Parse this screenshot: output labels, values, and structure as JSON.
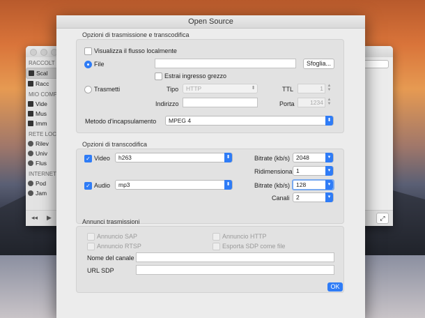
{
  "background_window": {
    "sidebar": {
      "sections": [
        {
          "header": "RACCOLT",
          "items": [
            {
              "label": "Scal"
            },
            {
              "label": "Racc"
            }
          ]
        },
        {
          "header": "MIO COMP",
          "items": [
            {
              "label": "Vide"
            },
            {
              "label": "Mus"
            },
            {
              "label": "Imm"
            }
          ]
        },
        {
          "header": "RETE LOC",
          "items": [
            {
              "label": "Rilev"
            },
            {
              "label": "Univ"
            },
            {
              "label": "Flus"
            }
          ]
        },
        {
          "header": "INTERNET",
          "items": [
            {
              "label": "Pod"
            },
            {
              "label": "Jam"
            }
          ]
        }
      ]
    }
  },
  "dialog": {
    "title": "Open Source",
    "streaming": {
      "group_title": "Opzioni di trasmissione e transcodifica",
      "show_locally_label": "Visualizza il flusso localmente",
      "file_label": "File",
      "file_value": "",
      "browse_label": "Sfoglia...",
      "raw_input_label": "Estrai ingresso grezzo",
      "transmit_label": "Trasmetti",
      "type_label": "Tipo",
      "type_value": "HTTP",
      "ttl_label": "TTL",
      "ttl_value": "1",
      "address_label": "Indirizzo",
      "address_value": "",
      "port_label": "Porta",
      "port_value": "1234",
      "encap_label": "Metodo d'incapsulamento",
      "encap_value": "MPEG 4"
    },
    "transcode": {
      "group_title": "Opzioni di transcodifica",
      "video_label": "Video",
      "video_codec": "h263",
      "video_bitrate_label": "Bitrate (kb/s)",
      "video_bitrate": "2048",
      "scale_label": "Ridimensiona",
      "scale_value": "1",
      "audio_label": "Audio",
      "audio_codec": "mp3",
      "audio_bitrate_label": "Bitrate (kb/s)",
      "audio_bitrate": "128",
      "channels_label": "Canali",
      "channels_value": "2"
    },
    "announce": {
      "group_title": "Annunci trasmissioni",
      "sap_label": "Annuncio SAP",
      "http_label": "Annuncio HTTP",
      "rtsp_label": "Annuncio RTSP",
      "export_sdp_label": "Esporta SDP come file",
      "channel_name_label": "Nome del canale",
      "channel_name_value": "",
      "sdp_url_label": "URL SDP",
      "sdp_url_value": ""
    },
    "ok_label": "OK"
  }
}
